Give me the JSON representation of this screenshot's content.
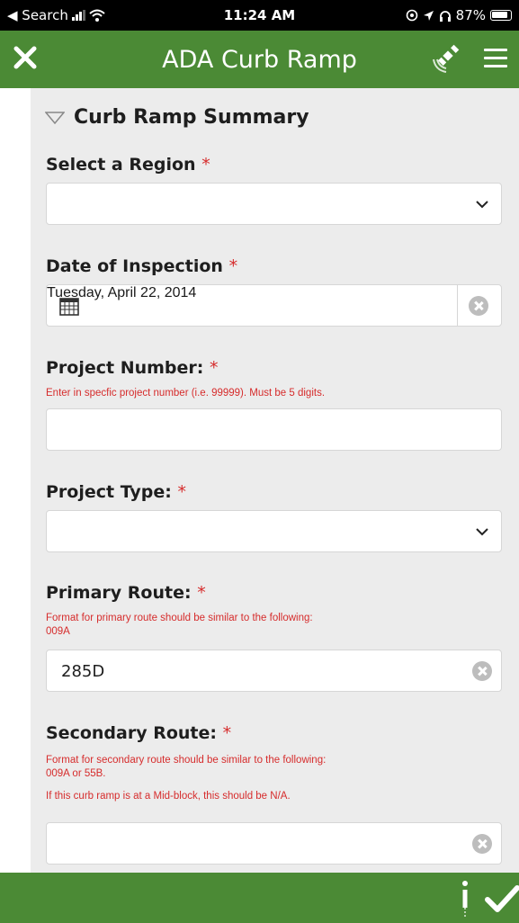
{
  "status_bar": {
    "back_label": "◀ Search",
    "time": "11:24 AM",
    "battery": "87%",
    "icons": [
      "signal-icon",
      "wifi-icon",
      "location-icon",
      "headphones-icon",
      "battery-icon"
    ]
  },
  "header": {
    "title": "ADA Curb Ramp",
    "icons": [
      "close-icon",
      "gps-icon",
      "menu-icon"
    ],
    "color": "#4b8a35"
  },
  "section": {
    "title": "Curb Ramp Summary"
  },
  "required_marker": "*",
  "fields": {
    "region": {
      "label": "Select a Region",
      "value": ""
    },
    "date": {
      "label": "Date of Inspection",
      "value": "Tuesday, April 22, 2014"
    },
    "project_number": {
      "label": "Project Number:",
      "hint": "Enter in specfic project number (i.e. 99999). Must be 5 digits.",
      "value": ""
    },
    "project_type": {
      "label": "Project Type:",
      "value": ""
    },
    "primary_route": {
      "label": "Primary Route:",
      "hint_line1": "Format for primary route should be similar to the following:",
      "hint_line2": "009A",
      "value": "285D"
    },
    "secondary_route": {
      "label": "Secondary Route:",
      "hint_line1": "Format for secondary route should be similar to the following:",
      "hint_line2": "009A or 55B.",
      "hint_line3": "If this curb ramp is at a Mid-block, this should be N/A.",
      "value": ""
    }
  },
  "colors": {
    "accent": "#4b8a35",
    "required": "#d62c2c",
    "panel": "#ececec"
  }
}
